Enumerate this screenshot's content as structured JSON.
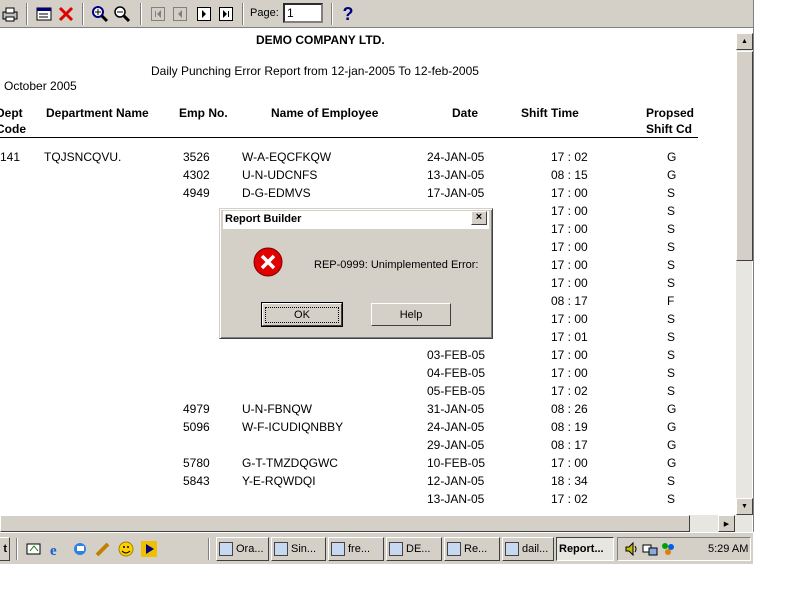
{
  "toolbar": {
    "page_label": "Page:",
    "page_value": "1",
    "help_glyph": "?"
  },
  "report": {
    "company": "DEMO COMPANY LTD.",
    "title": "Daily Punching Error Report from 12-jan-2005 To 12-feb-2005",
    "month": "October 2005",
    "headers": {
      "dept_code_1": "Dept",
      "dept_code_2": "Code",
      "dept_name": "Department Name",
      "emp_no": "Emp No.",
      "emp_name": "Name of Employee",
      "date": "Date",
      "shift_time": "Shift Time",
      "proposed_1": "Propsed",
      "proposed_2": "Shift Cd"
    },
    "rows": [
      {
        "dept": "141",
        "dname": "TQJSNCQVU.",
        "emp": "3526",
        "name": "W-A-EQCFKQW",
        "date": "24-JAN-05",
        "time": "17 : 02",
        "code": "G"
      },
      {
        "dept": "",
        "dname": "",
        "emp": "4302",
        "name": "U-N-UDCNFS",
        "date": "13-JAN-05",
        "time": "08 : 15",
        "code": "G"
      },
      {
        "dept": "",
        "dname": "",
        "emp": "4949",
        "name": "D-G-EDMVS",
        "date": "17-JAN-05",
        "time": "17 : 00",
        "code": "S"
      },
      {
        "dept": "",
        "dname": "",
        "emp": "",
        "name": "",
        "date": "",
        "time": "17 : 00",
        "code": "S"
      },
      {
        "dept": "",
        "dname": "",
        "emp": "",
        "name": "",
        "date": "",
        "time": "17 : 00",
        "code": "S"
      },
      {
        "dept": "",
        "dname": "",
        "emp": "",
        "name": "",
        "date": "",
        "time": "17 : 00",
        "code": "S"
      },
      {
        "dept": "",
        "dname": "",
        "emp": "",
        "name": "",
        "date": "",
        "time": "17 : 00",
        "code": "S"
      },
      {
        "dept": "",
        "dname": "",
        "emp": "",
        "name": "",
        "date": "",
        "time": "17 : 00",
        "code": "S"
      },
      {
        "dept": "",
        "dname": "",
        "emp": "",
        "name": "",
        "date": "",
        "time": "08 : 17",
        "code": "F"
      },
      {
        "dept": "",
        "dname": "",
        "emp": "",
        "name": "",
        "date": "",
        "time": "17 : 00",
        "code": "S"
      },
      {
        "dept": "",
        "dname": "",
        "emp": "",
        "name": "",
        "date": "",
        "time": "17 : 01",
        "code": "S"
      },
      {
        "dept": "",
        "dname": "",
        "emp": "",
        "name": "",
        "date": "03-FEB-05",
        "time": "17 : 00",
        "code": "S"
      },
      {
        "dept": "",
        "dname": "",
        "emp": "",
        "name": "",
        "date": "04-FEB-05",
        "time": "17 : 00",
        "code": "S"
      },
      {
        "dept": "",
        "dname": "",
        "emp": "",
        "name": "",
        "date": "05-FEB-05",
        "time": "17 : 02",
        "code": "S"
      },
      {
        "dept": "",
        "dname": "",
        "emp": "4979",
        "name": "U-N-FBNQW",
        "date": "31-JAN-05",
        "time": "08 : 26",
        "code": "G"
      },
      {
        "dept": "",
        "dname": "",
        "emp": "5096",
        "name": "W-F-ICUDIQNBBY",
        "date": "24-JAN-05",
        "time": "08 : 19",
        "code": "G"
      },
      {
        "dept": "",
        "dname": "",
        "emp": "",
        "name": "",
        "date": "29-JAN-05",
        "time": "08 : 17",
        "code": "G"
      },
      {
        "dept": "",
        "dname": "",
        "emp": "5780",
        "name": "G-T-TMZDQGWC",
        "date": "10-FEB-05",
        "time": "17 : 00",
        "code": "G"
      },
      {
        "dept": "",
        "dname": "",
        "emp": "5843",
        "name": "Y-E-RQWDQI",
        "date": "12-JAN-05",
        "time": "18 : 34",
        "code": "S"
      },
      {
        "dept": "",
        "dname": "",
        "emp": "",
        "name": "",
        "date": "13-JAN-05",
        "time": "17 : 02",
        "code": "S"
      }
    ]
  },
  "dialog": {
    "title": "Report Builder",
    "close_glyph": "×",
    "message": "REP-0999: Unimplemented Error:",
    "ok_label": "OK",
    "help_label": "Help"
  },
  "taskbar": {
    "start_label": "t",
    "tasks": [
      {
        "label": "Ora...",
        "active": false
      },
      {
        "label": "Sin...",
        "active": false
      },
      {
        "label": "fre...",
        "active": false
      },
      {
        "label": "DE...",
        "active": false
      },
      {
        "label": "Re...",
        "active": false
      },
      {
        "label": "dail...",
        "active": false
      },
      {
        "label": "Report...",
        "active": true
      }
    ],
    "clock": "5:29 AM"
  }
}
